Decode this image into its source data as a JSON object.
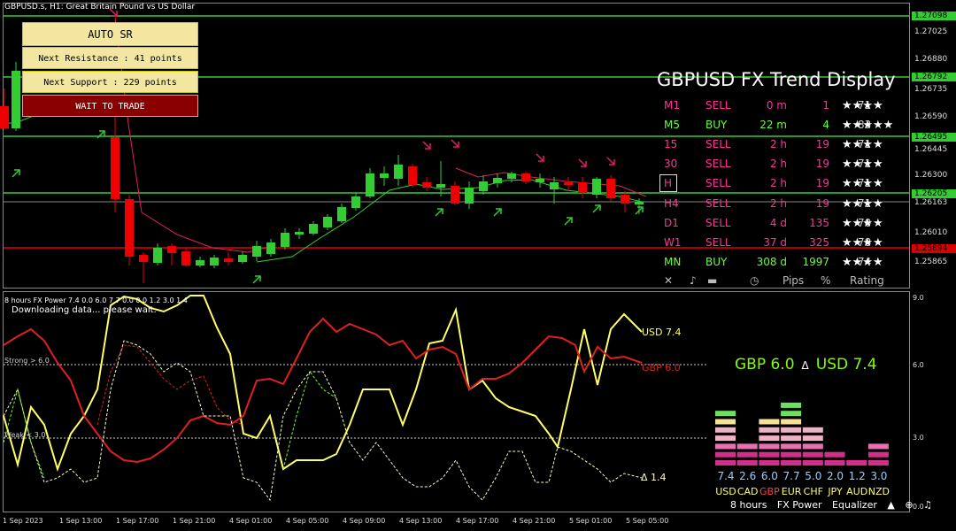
{
  "window_title": "GBPUSD.s, H1:  Great Britain Pound vs US Dollar",
  "auto_sr": {
    "title": "AUTO SR",
    "next_resistance": "Next Resistance : 41 points",
    "next_support": "Next Support : 229 points",
    "action": "WAIT TO TRADE"
  },
  "trend_display": {
    "title": "GBPUSD FX Trend Display",
    "rows": [
      {
        "tf": "M1",
        "dir": "SELL",
        "time": "0 m",
        "pips": "1",
        "pct": "71",
        "stars": "★★★★"
      },
      {
        "tf": "M5",
        "dir": "BUY",
        "time": "22 m",
        "pips": "4",
        "pct": "83",
        "stars": "★★★★★"
      },
      {
        "tf": "15",
        "dir": "SELL",
        "time": "2 h",
        "pips": "19",
        "pct": "71",
        "stars": "★★★★"
      },
      {
        "tf": "30",
        "dir": "SELL",
        "time": "2 h",
        "pips": "19",
        "pct": "71",
        "stars": "★★★★"
      },
      {
        "tf": "H",
        "dir": "SELL",
        "time": "2 h",
        "pips": "19",
        "pct": "71",
        "stars": "★★★★"
      },
      {
        "tf": "H4",
        "dir": "SELL",
        "time": "2 h",
        "pips": "19",
        "pct": "71",
        "stars": "★★★★"
      },
      {
        "tf": "D1",
        "dir": "SELL",
        "time": "4 d",
        "pips": "135",
        "pct": "70",
        "stars": "★★★★"
      },
      {
        "tf": "W1",
        "dir": "SELL",
        "time": "37 d",
        "pips": "325",
        "pct": "78",
        "stars": "★★★★"
      },
      {
        "tf": "MN",
        "dir": "BUY",
        "time": "308 d",
        "pips": "1997",
        "pct": "74",
        "stars": "★★★★"
      }
    ],
    "footer": {
      "close": "✕",
      "sound": "♪",
      "clock": "◷",
      "pips": "Pips",
      "pct": "%",
      "rating": "Rating"
    },
    "colors": {
      "sell": "#ff3399",
      "buy": "#66ff33"
    }
  },
  "price_axis": {
    "labels": [
      "1.27098",
      "1.27025",
      "1.26880",
      "1.26792",
      "1.26735",
      "1.26590",
      "1.26495",
      "1.26445",
      "1.26300",
      "1.26205",
      "1.26163",
      "1.26010",
      "1.25894",
      "1.25865"
    ],
    "highlight_green": [
      "1.27098",
      "1.26792",
      "1.26495",
      "1.26205"
    ],
    "highlight_red": [
      "1.25894"
    ]
  },
  "indicator": {
    "header": "8 hours FX Power 7.4 0.0 6.0 7.7 0.0 0.0 1.2 3.0 1.4",
    "status": "Downloading data... please wait.",
    "strong_label": "Strong > 6.0",
    "weak_label": "Weak < 3.0",
    "axis": [
      "9.0",
      "6.0",
      "3.0",
      "0.0"
    ],
    "usd_label": "USD 7.4",
    "gbp_label": "GBP 6.0",
    "delta_label": "Δ 1.4",
    "summary_gbp": "GBP 6.0",
    "summary_delta": "Δ",
    "summary_usd": "USD 7.4",
    "equalizer": {
      "values": [
        "7.4",
        "2.6",
        "6.0",
        "7.7",
        "5.0",
        "2.0",
        "1.2",
        "3.0"
      ],
      "currencies": [
        "USD",
        "CAD",
        "GBP",
        "EUR",
        "CHF",
        "JPY",
        "AUD",
        "NZD"
      ],
      "levels": [
        7.4,
        2.6,
        6.0,
        7.7,
        5.0,
        2.0,
        1.2,
        3.0
      ]
    },
    "footer": {
      "period": "8 hours",
      "name": "FX Power",
      "mode": "Equalizer"
    }
  },
  "time_axis": [
    "1 Sep 2023",
    "1 Sep 13:00",
    "1 Sep 17:00",
    "1 Sep 21:00",
    "4 Sep 01:00",
    "4 Sep 05:00",
    "4 Sep 09:00",
    "4 Sep 13:00",
    "4 Sep 17:00",
    "4 Sep 21:00",
    "5 Sep 01:00",
    "5 Sep 05:00"
  ]
}
